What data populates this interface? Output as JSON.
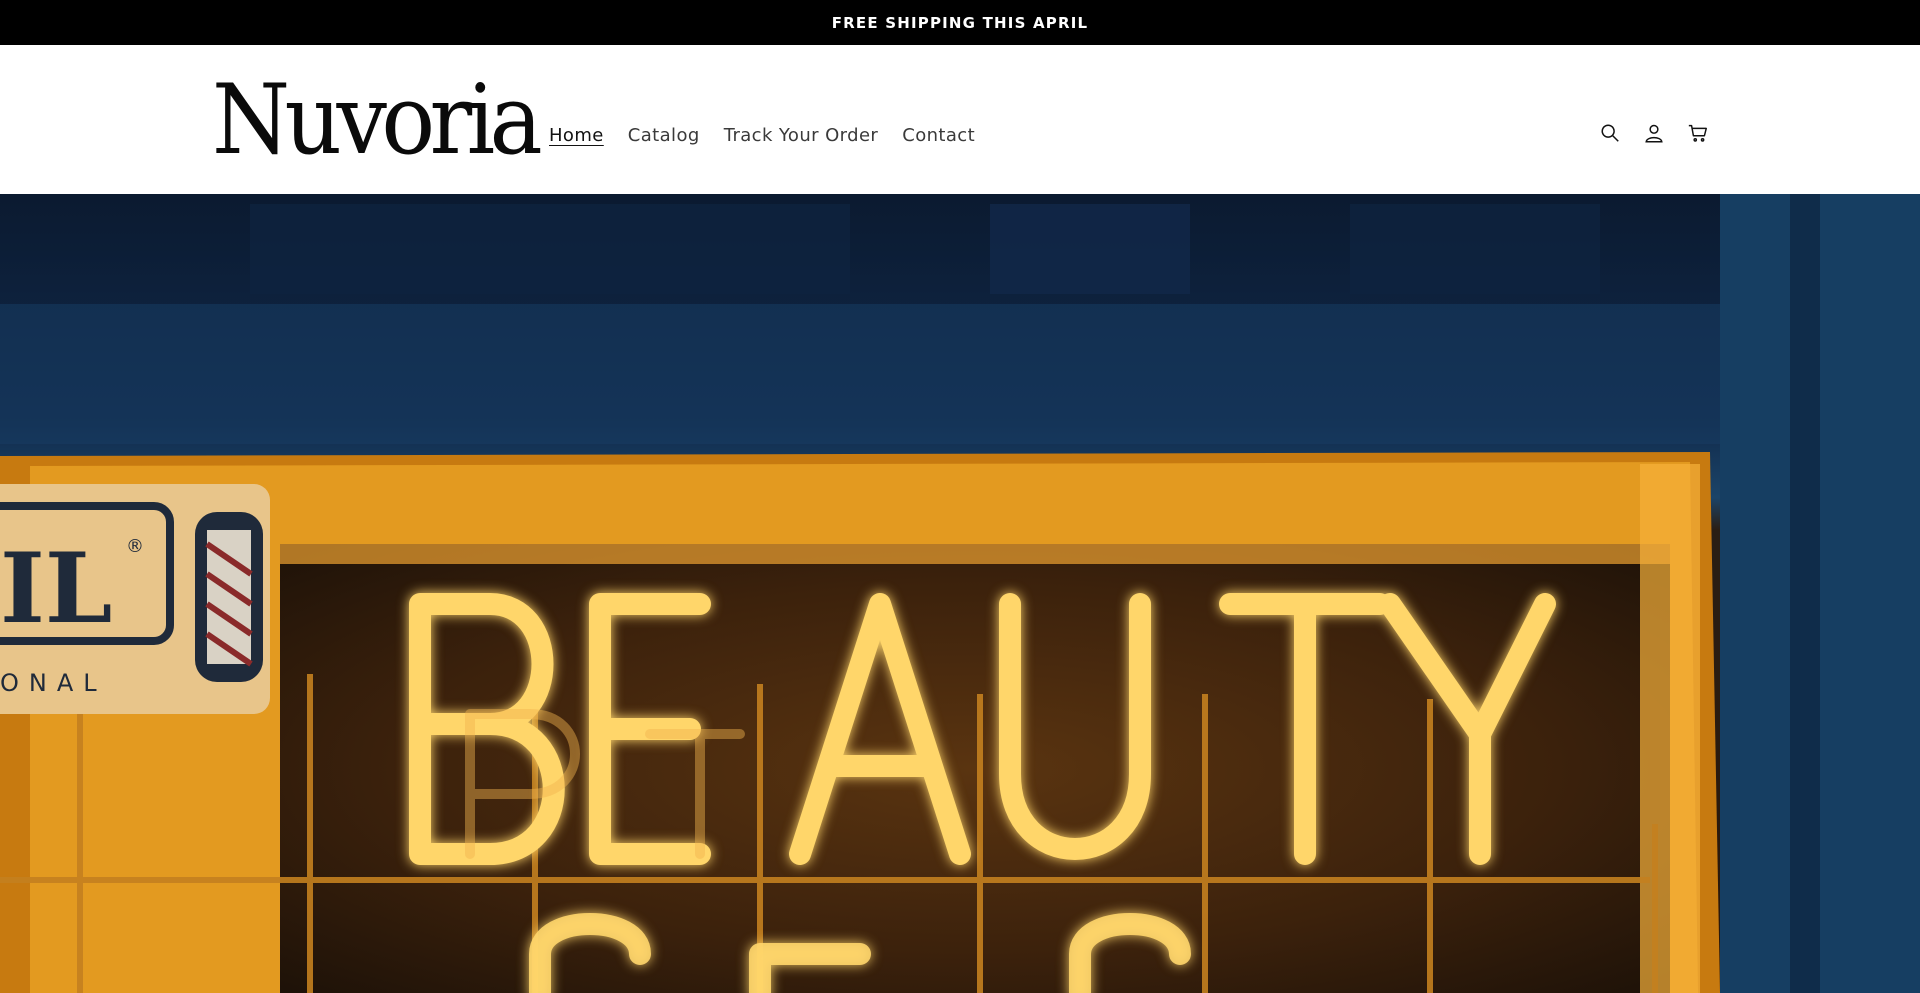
{
  "announcement": {
    "text": "FREE SHIPPING THIS APRIL"
  },
  "header": {
    "logo_text": "Nuvoria",
    "nav": [
      {
        "label": "Home",
        "active": true
      },
      {
        "label": "Catalog",
        "active": false
      },
      {
        "label": "Track Your Order",
        "active": false
      },
      {
        "label": "Contact",
        "active": false
      }
    ],
    "icons": [
      "search-icon",
      "account-icon",
      "cart-icon"
    ]
  },
  "hero": {
    "image_description_sign_text": "BEAUTY",
    "side_sign_text": "IL",
    "side_sign_subtext": "ONAL",
    "colors": {
      "sky": "#0d1f38",
      "neon": "#ffd66b",
      "glow": "#e8961e",
      "frame": "#c97a12"
    }
  }
}
